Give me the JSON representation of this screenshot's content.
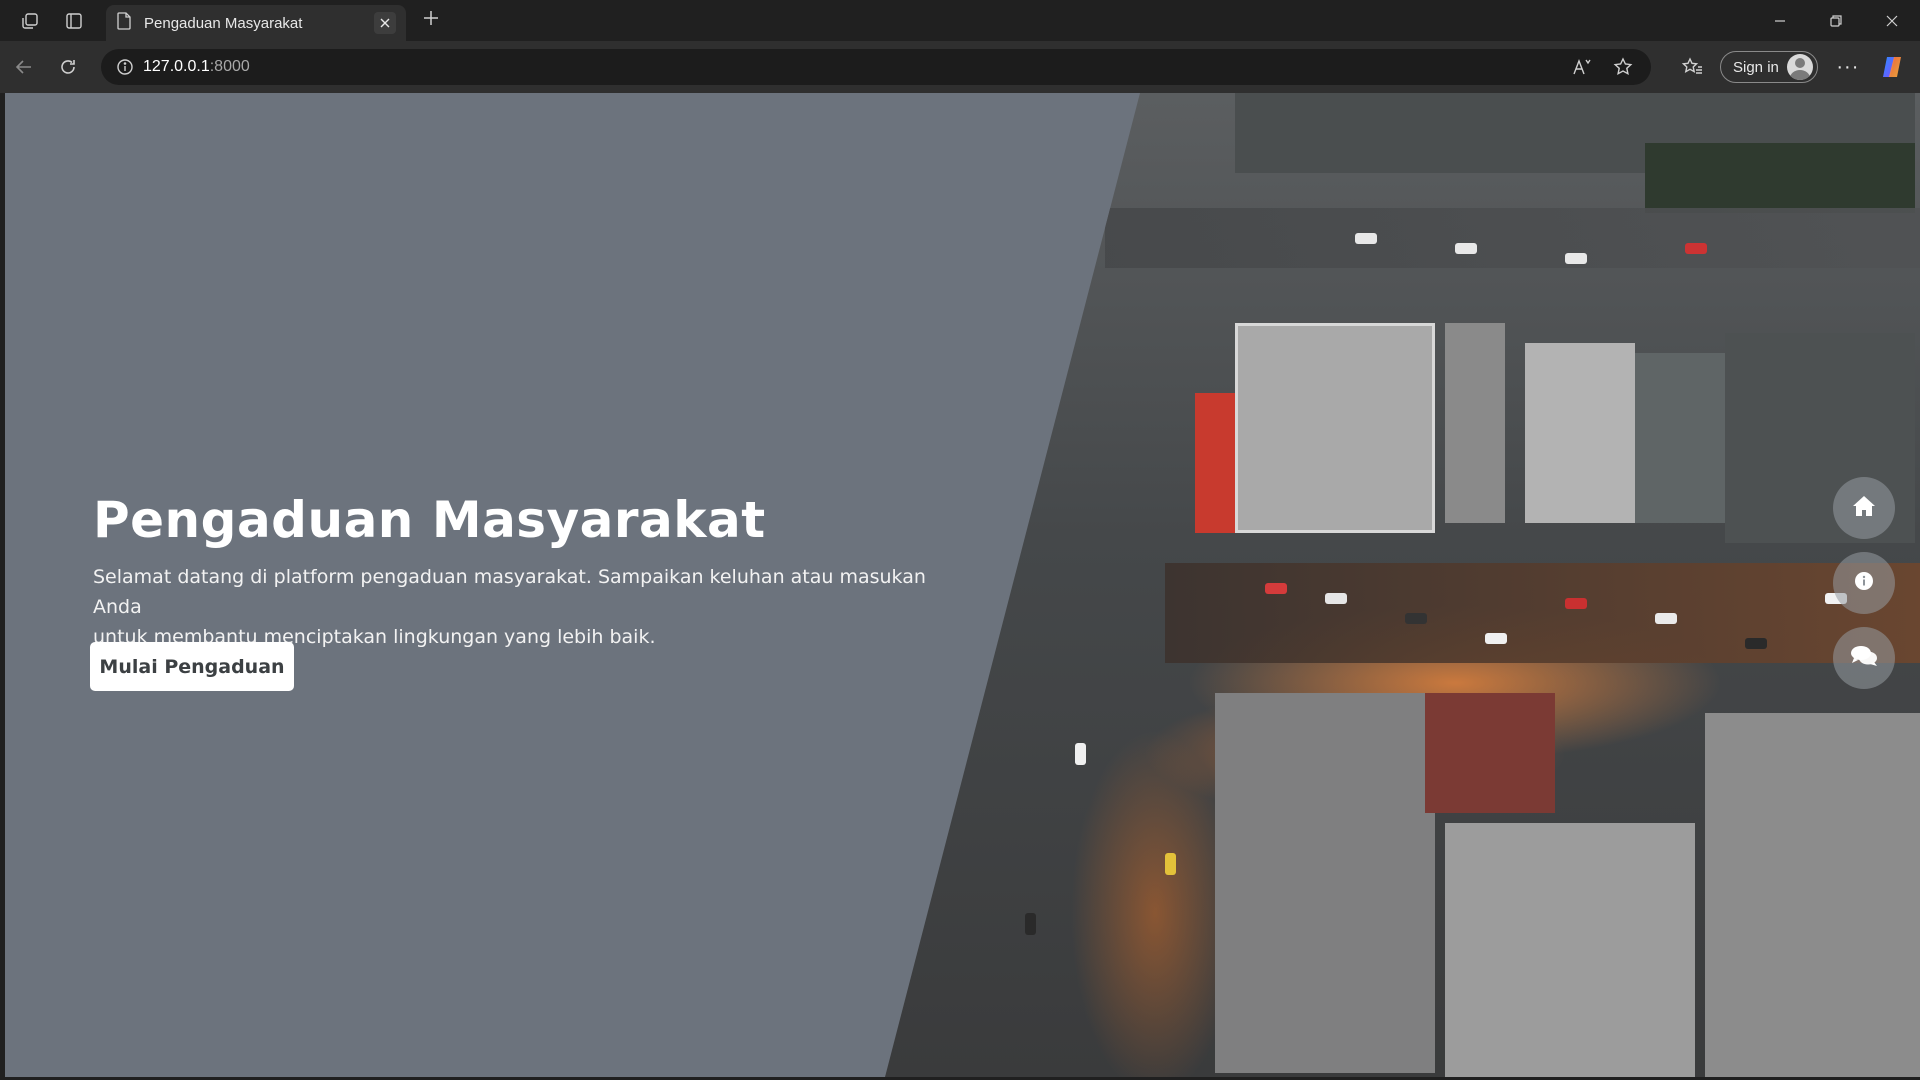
{
  "browser": {
    "tab": {
      "title": "Pengaduan Masyarakat",
      "icon": "page-icon"
    },
    "address": {
      "host": "127.0.0.1",
      "port": ":8000"
    },
    "signin_label": "Sign in",
    "icons": [
      "workspaces-icon",
      "tab-actions-icon",
      "close-icon",
      "plus-icon",
      "minimize-icon",
      "restore-icon",
      "back-icon",
      "reload-icon",
      "info-icon",
      "read-aloud-icon",
      "star-icon",
      "favorites-icon",
      "more-icon",
      "copilot-icon"
    ]
  },
  "hero": {
    "title": "Pengaduan Masyarakat",
    "description_line1": "Selamat datang di platform pengaduan masyarakat. Sampaikan keluhan atau masukan Anda",
    "description_line2": "untuk membantu menciptakan lingkungan yang lebih baik.",
    "cta_label": "Mulai Pengaduan",
    "background_color": "#6c737d",
    "image_subject": "aerial city view at dusk"
  },
  "floating_nav": {
    "items": [
      {
        "icon": "home-icon"
      },
      {
        "icon": "info-icon"
      },
      {
        "icon": "chat-icon"
      }
    ]
  },
  "colors": {
    "chrome_dark": "#202020",
    "toolbar": "#2f2f2f",
    "button_bg": "#ffffff",
    "button_text": "#3c4043"
  }
}
